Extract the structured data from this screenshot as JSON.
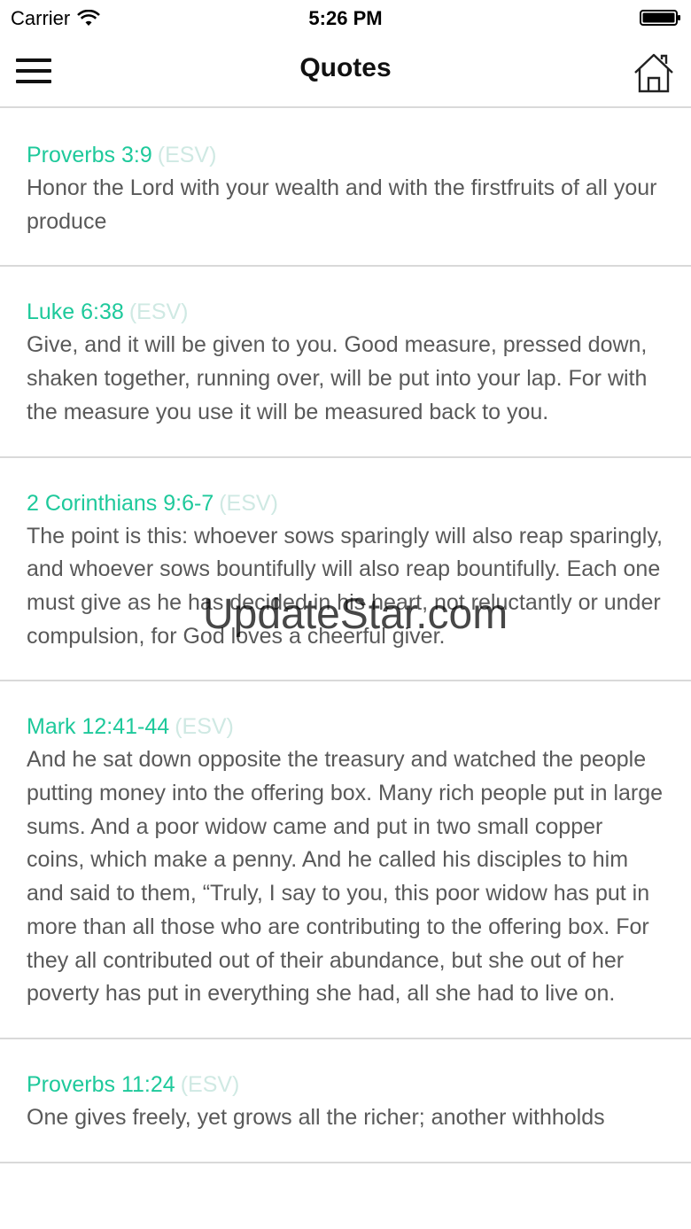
{
  "status_bar": {
    "carrier": "Carrier",
    "time": "5:26 PM",
    "icons": [
      "wifi-icon",
      "battery-icon"
    ]
  },
  "nav": {
    "title": "Quotes",
    "left_icon": "menu-icon",
    "right_icon": "home-icon"
  },
  "colors": {
    "reference": "#1ec99b",
    "version": "#cfe9e3",
    "body_text": "#595959",
    "divider": "#d9d9d9"
  },
  "quotes": [
    {
      "ref": "Proverbs 3:9",
      "version": "(ESV)",
      "text": "Honor the Lord with your wealth and with the firstfruits of all your produce"
    },
    {
      "ref": "Luke 6:38",
      "version": "(ESV)",
      "text": "Give, and it will be given to you. Good measure, pressed down, shaken together, running over, will be put into your lap. For with the measure you use it will be measured back to you."
    },
    {
      "ref": "2 Corinthians 9:6-7",
      "version": "(ESV)",
      "text": "The point is this: whoever sows sparingly will also reap sparingly, and whoever sows bountifully will also reap bountifully. Each one must give as he has decided in his heart, not reluctantly or under compulsion, for God loves a cheerful giver."
    },
    {
      "ref": "Mark 12:41-44",
      "version": "(ESV)",
      "text": "And he sat down opposite the treasury and watched the people putting money into the offering box. Many rich people put in large sums. And a poor widow came and put in two small copper coins, which make a penny. And he called his disciples to him and said to them, “Truly, I say to you, this poor widow has put in more than all those who are contributing to the offering box. For they all contributed out of their abundance, but she out of her poverty has put in everything she had, all she had to live on."
    },
    {
      "ref": "Proverbs 11:24",
      "version": "(ESV)",
      "text": "One gives freely, yet grows all the richer; another withholds"
    }
  ],
  "watermark": "UpdateStar.com"
}
